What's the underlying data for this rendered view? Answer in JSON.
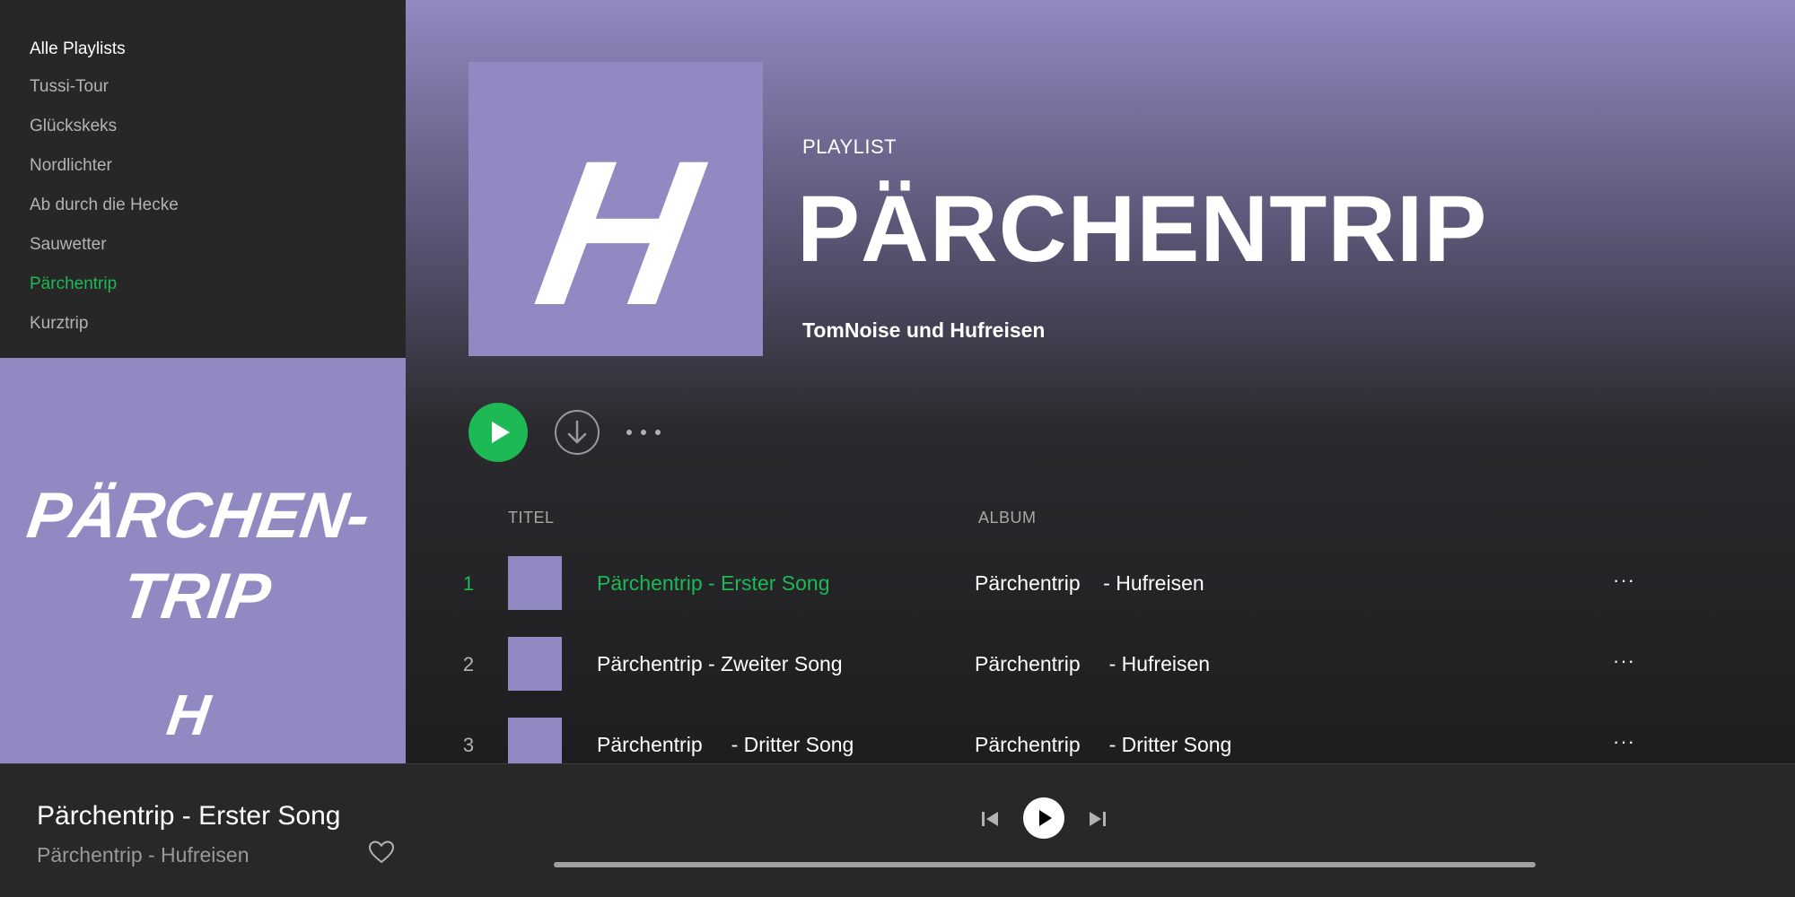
{
  "sidebar": {
    "heading": "Alle Playlists",
    "items": [
      {
        "label": "Tussi-Tour",
        "active": false
      },
      {
        "label": "Glückskeks",
        "active": false
      },
      {
        "label": "Nordlichter",
        "active": false
      },
      {
        "label": "Ab durch die Hecke",
        "active": false
      },
      {
        "label": "Sauwetter",
        "active": false
      },
      {
        "label": "Pärchentrip",
        "active": true
      },
      {
        "label": "Kurztrip",
        "active": false
      }
    ],
    "art_lines": [
      "PÄRCHEN-",
      "TRIP",
      "H"
    ]
  },
  "playlist": {
    "type_label": "PLAYLIST",
    "title": "PÄRCHENTRIP",
    "owner": "TomNoise und Hufreisen",
    "cover_glyph": "H"
  },
  "controls": {
    "play_icon": "play-icon",
    "download_icon": "download-icon",
    "more_icon": "more-horizontal-icon"
  },
  "tracklist": {
    "headers": {
      "title": "TITEL",
      "album": "ALBUM"
    },
    "tracks": [
      {
        "num": "1",
        "title": "Pärchentrip - Erster Song",
        "album": "Pärchentrip    - Hufreisen",
        "more": "···",
        "playing": true
      },
      {
        "num": "2",
        "title": "Pärchentrip - Zweiter Song",
        "album": "Pärchentrip     - Hufreisen",
        "more": "···",
        "playing": false
      },
      {
        "num": "3",
        "title": "Pärchentrip     - Dritter Song",
        "album": "Pärchentrip     - Dritter Song",
        "more": "···",
        "playing": false
      }
    ]
  },
  "player": {
    "now_title": "Pärchentrip - Erster Song",
    "now_sub": "Pärchentrip - Hufreisen",
    "progress": 0
  },
  "colors": {
    "accent": "#1db954",
    "lavender": "#9189c1",
    "sidebar_bg": "#272727",
    "player_bg": "#282828"
  }
}
